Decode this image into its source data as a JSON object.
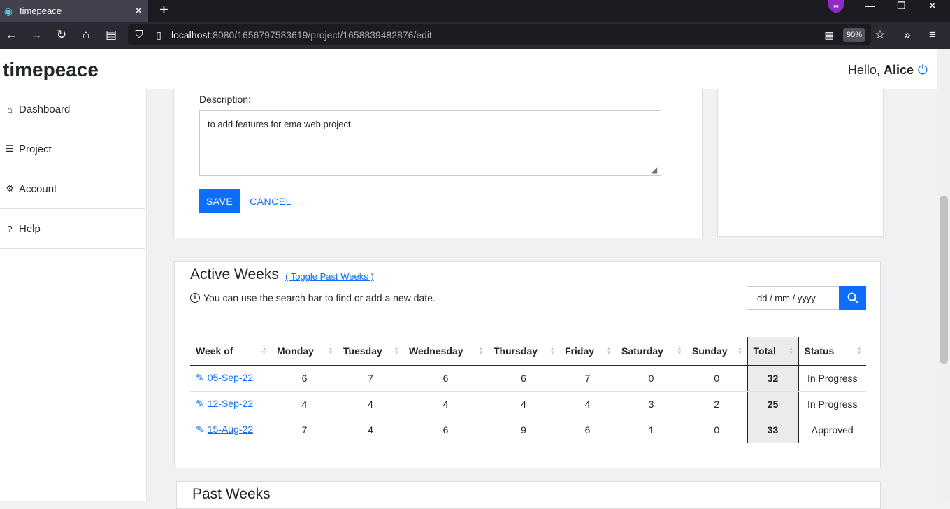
{
  "browser": {
    "tab_title": "timepeace",
    "url_host": "localhost",
    "url_rest": ":8080/1656797583619/project/1658839482876/edit",
    "zoom": "90%"
  },
  "app": {
    "brand": "timepeace",
    "greeting": "Hello,",
    "user": "Alice"
  },
  "sidebar": {
    "items": [
      {
        "label": "Dashboard",
        "icon": "home-icon"
      },
      {
        "label": "Project",
        "icon": "list-icon"
      },
      {
        "label": "Account",
        "icon": "gear-icon"
      },
      {
        "label": "Help",
        "icon": "help-icon"
      }
    ]
  },
  "edit_form": {
    "description_label": "Description:",
    "description_value": "to add features for ema web project.",
    "save_label": "SAVE",
    "cancel_label": "CANCEL"
  },
  "active_weeks": {
    "title": "Active Weeks",
    "toggle_label": "( Toggle Past Weeks )",
    "info_text": "You can use the search bar to find or add a new date.",
    "date_placeholder": "dd / mm / yyyy",
    "columns": [
      "Week of",
      "Monday",
      "Tuesday",
      "Wednesday",
      "Thursday",
      "Friday",
      "Saturday",
      "Sunday",
      "Total",
      "Status"
    ],
    "rows": [
      {
        "week": "05-Sep-22",
        "mon": "6",
        "tue": "7",
        "wed": "6",
        "thu": "6",
        "fri": "7",
        "sat": "0",
        "sun": "0",
        "total": "32",
        "status": "In Progress"
      },
      {
        "week": "12-Sep-22",
        "mon": "4",
        "tue": "4",
        "wed": "4",
        "thu": "4",
        "fri": "4",
        "sat": "3",
        "sun": "2",
        "total": "25",
        "status": "In Progress"
      },
      {
        "week": "15-Aug-22",
        "mon": "7",
        "tue": "4",
        "wed": "6",
        "thu": "9",
        "fri": "6",
        "sat": "1",
        "sun": "0",
        "total": "33",
        "status": "Approved"
      }
    ]
  },
  "past_weeks": {
    "title": "Past Weeks"
  },
  "colors": {
    "accent": "#0d6efd",
    "total_bg": "#e9ebec"
  }
}
